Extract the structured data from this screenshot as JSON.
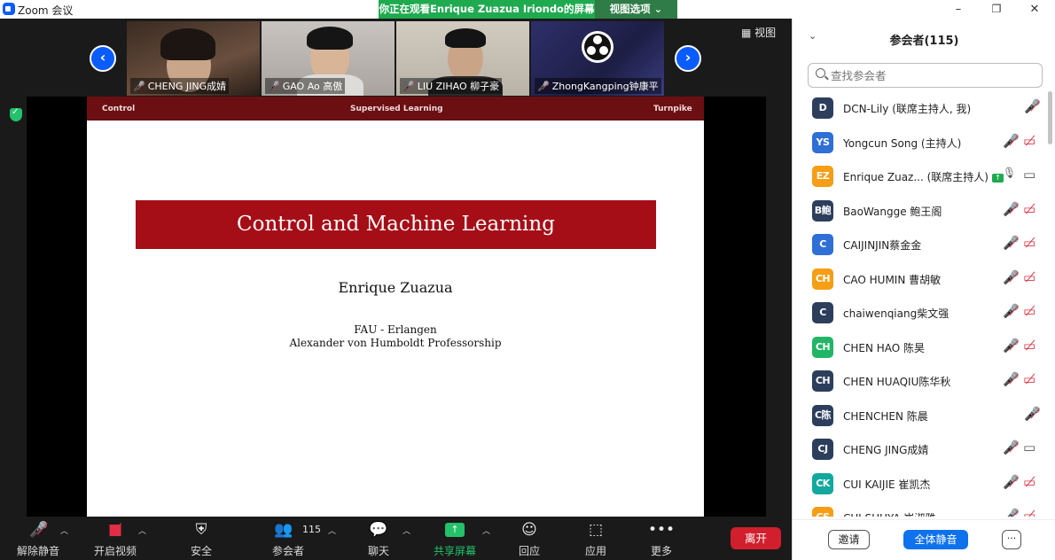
{
  "window": {
    "title": "Zoom 会议",
    "minimize": "–",
    "restore": "❐",
    "close": "✕"
  },
  "share_banner": {
    "text": "你正在观看Enrique Zuazua Iriondo的屏幕",
    "view_options": "视图选项 ⌄"
  },
  "meeting": {
    "view_label": "视图",
    "thumbnails": [
      {
        "name": "CHENG JING成婧"
      },
      {
        "name": "GAO Ao 高傲"
      },
      {
        "name": "LIU ZIHAO 柳子豪"
      },
      {
        "name": "ZhongKangping钟康平"
      }
    ]
  },
  "slide": {
    "header_left": "Control",
    "header_center": "Supervised Learning",
    "header_right": "Turnpike",
    "title": "Control and Machine Learning",
    "author": "Enrique Zuazua",
    "affiliation_1": "FAU - Erlangen",
    "affiliation_2": "Alexander von Humboldt Professorship"
  },
  "toolbar": {
    "unmute": "解除静音",
    "start_video": "开启视频",
    "security": "安全",
    "participants": "参会者",
    "participant_count": "115",
    "chat": "聊天",
    "share_screen": "共享屏幕",
    "reactions": "回应",
    "apps": "应用",
    "more": "更多",
    "leave": "离开"
  },
  "panel": {
    "title": "参会者(115)",
    "search_placeholder": "查找参会者",
    "participants": [
      {
        "initials": "D",
        "name": "DCN-Lily (联席主持人, 我)",
        "color": "#2c3e5c",
        "mic": "muted",
        "cam": "none"
      },
      {
        "initials": "YS",
        "name": "Yongcun Song (主持人)",
        "color": "#2f6fd6",
        "mic": "muted",
        "cam": "off"
      },
      {
        "initials": "EZ",
        "name": "Enrique Zuaz...  (联席主持人)",
        "color": "#f59e16",
        "mic": "on",
        "cam": "on-gray",
        "sharing": true
      },
      {
        "initials": "B鲍",
        "name": "BaoWangge 鲍王阁",
        "color": "#2c3e5c",
        "mic": "muted",
        "cam": "off"
      },
      {
        "initials": "C",
        "name": "CAIJINJIN蔡金金",
        "color": "#2f6fd6",
        "mic": "muted",
        "cam": "off"
      },
      {
        "initials": "CH",
        "name": "CAO HUMIN 曹胡敏",
        "color": "#f59e16",
        "mic": "muted",
        "cam": "off"
      },
      {
        "initials": "C",
        "name": "chaiwenqiang柴文强",
        "color": "#2c3e5c",
        "mic": "muted",
        "cam": "off"
      },
      {
        "initials": "CH",
        "name": "CHEN HAO 陈昊",
        "color": "#23b566",
        "mic": "muted",
        "cam": "off"
      },
      {
        "initials": "CH",
        "name": "CHEN HUAQIU陈华秋",
        "color": "#2c3e5c",
        "mic": "muted",
        "cam": "off"
      },
      {
        "initials": "C陈",
        "name": "CHENCHEN 陈晨",
        "color": "#2c3e5c",
        "mic": "muted",
        "cam": "none"
      },
      {
        "initials": "CJ",
        "name": "CHENG JING成婧",
        "color": "#2c3e5c",
        "mic": "muted",
        "cam": "on-gray"
      },
      {
        "initials": "CK",
        "name": "CUI KAIJIE 崔凯杰",
        "color": "#13a89e",
        "mic": "muted",
        "cam": "off"
      },
      {
        "initials": "CS",
        "name": "CUI SHUYA 崔淑雅",
        "color": "#f59e16",
        "mic": "muted",
        "cam": "off"
      }
    ],
    "invite": "邀请",
    "mute_all": "全体静音",
    "more": "···"
  }
}
